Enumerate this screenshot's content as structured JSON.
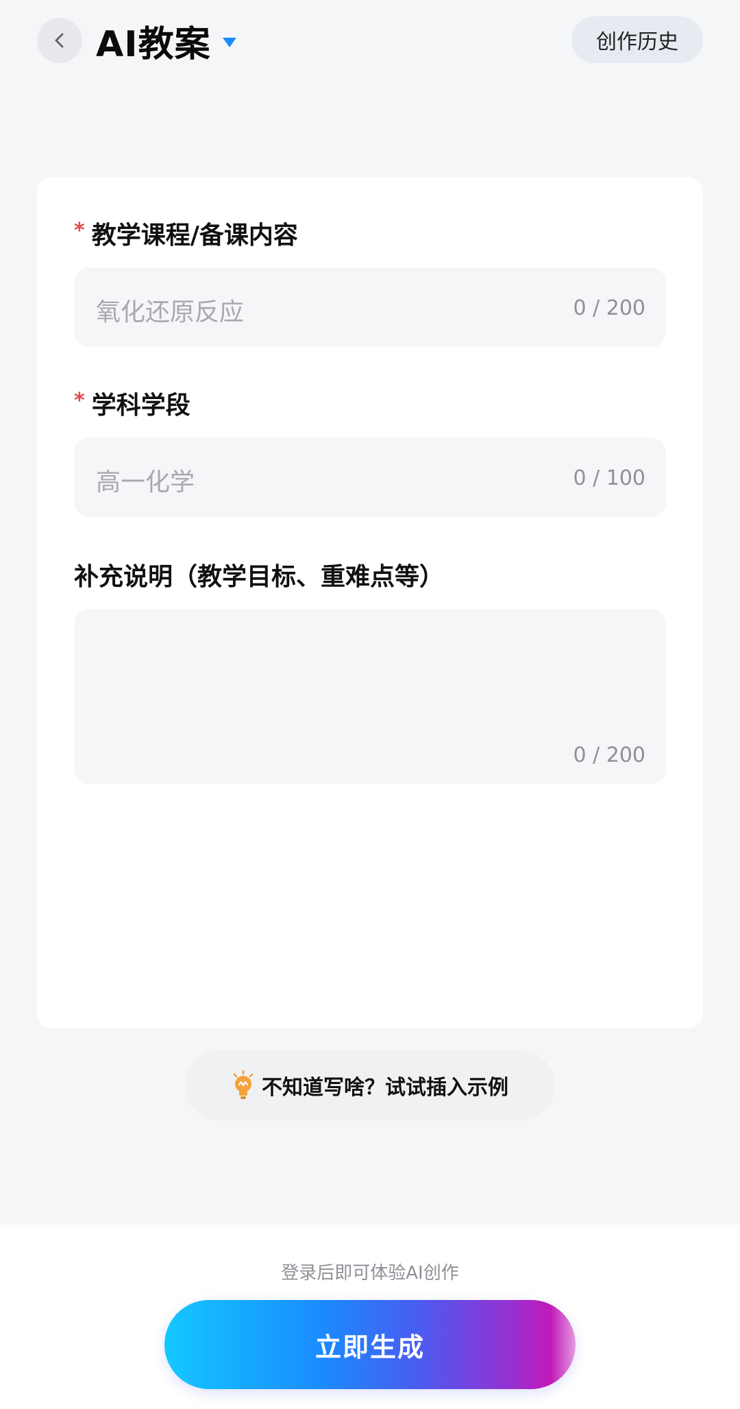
{
  "header": {
    "title": "AI教案",
    "history_label": "创作历史"
  },
  "form": {
    "fields": [
      {
        "label": "教学课程/备课内容",
        "required": true,
        "placeholder": "氧化还原反应",
        "counter": "0 / 200"
      },
      {
        "label": "学科学段",
        "required": true,
        "placeholder": "高一化学",
        "counter": "0 / 100"
      },
      {
        "label": "补充说明（教学目标、重难点等）",
        "required": false,
        "placeholder": "",
        "counter": "0 / 200"
      }
    ],
    "required_mark": "*"
  },
  "example": {
    "label": "不知道写啥？试试插入示例",
    "icon": "lightbulb-icon"
  },
  "bottom": {
    "login_hint": "登录后即可体验AI创作",
    "generate_label": "立即生成"
  },
  "colors": {
    "accent_blue": "#1a8cff",
    "required_red": "#e5484d",
    "gradient_start": "#13c8ff",
    "gradient_end": "#c21ab8"
  }
}
